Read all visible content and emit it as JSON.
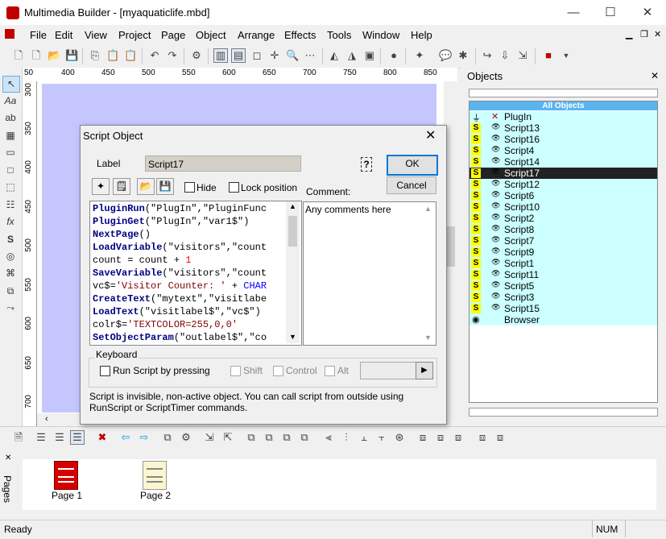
{
  "window": {
    "title": "Multimedia Builder - [myaquaticlife.mbd]",
    "minimize": "—",
    "maximize": "☐",
    "close": "✕"
  },
  "menu": {
    "items": [
      "File",
      "Edit",
      "View",
      "Project",
      "Page",
      "Object",
      "Arrange",
      "Effects",
      "Tools",
      "Window",
      "Help"
    ]
  },
  "rulers": {
    "top_ticks": [
      "50",
      "400",
      "450",
      "500",
      "550",
      "600",
      "650",
      "700",
      "750",
      "800",
      "850"
    ],
    "left_ticks": [
      "300",
      "350",
      "400",
      "450",
      "500",
      "550",
      "600",
      "650",
      "700"
    ]
  },
  "objects_panel": {
    "title": "Objects",
    "close": "✕",
    "header": "All Objects",
    "items": [
      {
        "label": "PlugIn",
        "type": "plugin",
        "selected": false
      },
      {
        "label": "Script13",
        "type": "script",
        "selected": false
      },
      {
        "label": "Script16",
        "type": "script",
        "selected": false
      },
      {
        "label": "Script4",
        "type": "script",
        "selected": false
      },
      {
        "label": "Script14",
        "type": "script",
        "selected": false
      },
      {
        "label": "Script17",
        "type": "script",
        "selected": true
      },
      {
        "label": "Script12",
        "type": "script",
        "selected": false
      },
      {
        "label": "Script6",
        "type": "script",
        "selected": false
      },
      {
        "label": "Script10",
        "type": "script",
        "selected": false
      },
      {
        "label": "Script2",
        "type": "script",
        "selected": false
      },
      {
        "label": "Script8",
        "type": "script",
        "selected": false
      },
      {
        "label": "Script7",
        "type": "script",
        "selected": false
      },
      {
        "label": "Script9",
        "type": "script",
        "selected": false
      },
      {
        "label": "Script1",
        "type": "script",
        "selected": false
      },
      {
        "label": "Script11",
        "type": "script",
        "selected": false
      },
      {
        "label": "Script5",
        "type": "script",
        "selected": false
      },
      {
        "label": "Script3",
        "type": "script",
        "selected": false
      },
      {
        "label": "Script15",
        "type": "script",
        "selected": false
      },
      {
        "label": "Browser",
        "type": "browser",
        "selected": false
      }
    ]
  },
  "dialog": {
    "title": "Script Object",
    "close": "✕",
    "label_caption": "Label",
    "label_value": "Script17",
    "help_glyph": "?",
    "ok": "OK",
    "cancel": "Cancel",
    "hide": "Hide",
    "lock_position": "Lock position",
    "comment_caption": "Comment:",
    "comment_text": "Any comments here",
    "code_lines": [
      [
        {
          "t": "PluginRun",
          "c": "kw"
        },
        {
          "t": "(\"PlugIn\",\"PluginFunc",
          "c": ""
        }
      ],
      [
        {
          "t": "PluginGet",
          "c": "kw"
        },
        {
          "t": "(\"PlugIn\",\"var1$\")",
          "c": ""
        }
      ],
      [
        {
          "t": "NextPage",
          "c": "kw"
        },
        {
          "t": "()",
          "c": ""
        }
      ],
      [
        {
          "t": "LoadVariable",
          "c": "kw"
        },
        {
          "t": "(\"visitors\",\"count",
          "c": ""
        }
      ],
      [
        {
          "t": "count = count + ",
          "c": ""
        },
        {
          "t": "1",
          "c": "num"
        }
      ],
      [
        {
          "t": "SaveVariable",
          "c": "kw"
        },
        {
          "t": "(\"visitors\",\"count",
          "c": ""
        }
      ],
      [
        {
          "t": "vc$=",
          "c": ""
        },
        {
          "t": "'Visitor Counter: '",
          "c": "str"
        },
        {
          "t": " + ",
          "c": ""
        },
        {
          "t": "CHAR",
          "c": "cst"
        }
      ],
      [
        {
          "t": "CreateText",
          "c": "kw"
        },
        {
          "t": "(\"mytext\",\"visitlabe",
          "c": ""
        }
      ],
      [
        {
          "t": "LoadText",
          "c": "kw"
        },
        {
          "t": "(\"visitlabel$\",\"vc$\")",
          "c": ""
        }
      ],
      [
        {
          "t": "colr$=",
          "c": ""
        },
        {
          "t": "'TEXTCOLOR=255,0,0'",
          "c": "str"
        }
      ],
      [
        {
          "t": "SetObjectParam",
          "c": "kw"
        },
        {
          "t": "(\"outlabel$\",\"co",
          "c": ""
        }
      ]
    ],
    "keyboard_caption": "Keyboard",
    "run_script_by_pressing": "Run Script by pressing",
    "shift": "Shift",
    "control": "Control",
    "alt": "Alt",
    "footer_text": "Script is invisible, non-active object. You can call script from outside using RunScript or ScriptTimer commands."
  },
  "pages": {
    "label": "Pages",
    "items": [
      "Page 1",
      "Page 2"
    ]
  },
  "status": {
    "text": "Ready",
    "num": "NUM"
  },
  "colors": {
    "page_bg": "#c6c6ff",
    "selected_row": "#222222",
    "obj_row": "#ccffff",
    "header": "#5ab4f0"
  }
}
